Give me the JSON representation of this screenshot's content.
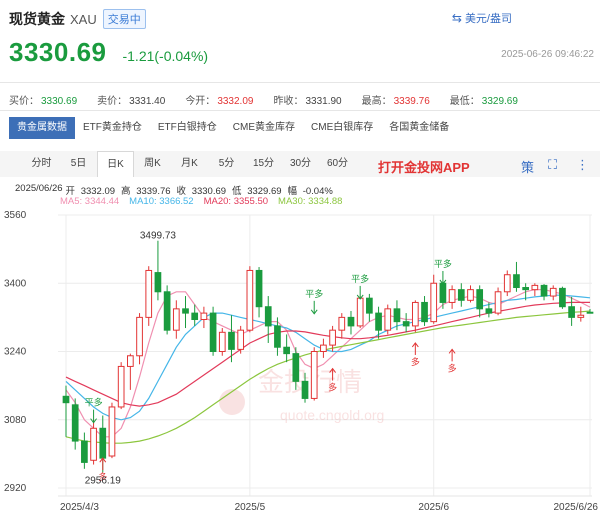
{
  "header": {
    "title": "现货黄金",
    "code": "XAU",
    "status": "交易中",
    "unit_switch": "美元/盎司",
    "price": "3330.69",
    "change": "-1.21(-0.04%)",
    "timestamp": "2025-06-26 09:46:22"
  },
  "quotes": [
    {
      "label": "买价：",
      "value": "3330.69",
      "tone": "down"
    },
    {
      "label": "卖价：",
      "value": "3331.40",
      "tone": "flat"
    },
    {
      "label": "今开：",
      "value": "3332.09",
      "tone": "up"
    },
    {
      "label": "昨收：",
      "value": "3331.90",
      "tone": "flat"
    },
    {
      "label": "最高：",
      "value": "3339.76",
      "tone": "up"
    },
    {
      "label": "最低：",
      "value": "3329.69",
      "tone": "down"
    }
  ],
  "tabs": [
    "贵金属数据",
    "ETF黄金持仓",
    "ETF白银持仓",
    "CME黄金库存",
    "CME白银库存",
    "各国黄金储备"
  ],
  "periods": [
    "分时",
    "5日",
    "日K",
    "周K",
    "月K",
    "5分",
    "15分",
    "30分",
    "60分"
  ],
  "active_period": "日K",
  "app_link": "打开金投网APP",
  "tool_icon": "策",
  "ohlc": {
    "date": "2025/06/26",
    "open_label": "开",
    "open": "3332.09",
    "high_label": "高",
    "high": "3339.76",
    "close_label": "收",
    "close": "3330.69",
    "low_label": "低",
    "low": "3329.69",
    "change_label": "幅",
    "change": "-0.04%"
  },
  "ma": [
    {
      "text": "MA5: 3344.44",
      "color": "#f08fb0"
    },
    {
      "text": "MA10: 3366.52",
      "color": "#45b6e8"
    },
    {
      "text": "MA20: 3355.50",
      "color": "#e23a5a"
    },
    {
      "text": "MA30: 3334.88",
      "color": "#8cc63e"
    }
  ],
  "watermark": "quote.cngold.org",
  "colors": {
    "up": "#e23434",
    "down": "#1a9b3e",
    "accent": "#3d6fb7"
  },
  "chart_data": {
    "type": "candlestick",
    "y_ticks": [
      "3560",
      "3400",
      "3240",
      "3080",
      "2920"
    ],
    "y_tick_values": [
      3560,
      3400,
      3240,
      3080,
      2920
    ],
    "ylim": [
      2920,
      3560
    ],
    "x_ticks": [
      {
        "label": "2025/4/3",
        "index": 0
      },
      {
        "label": "2025/5",
        "index": 20
      },
      {
        "label": "2025/6",
        "index": 40
      },
      {
        "label": "2025/6/26",
        "index": 57
      }
    ],
    "annotations": [
      {
        "label": "3499.73",
        "index": 10,
        "value": 3499.73,
        "kind": "high"
      },
      {
        "label": "2956.19",
        "index": 4,
        "value": 2956.19,
        "kind": "low"
      }
    ],
    "signals": [
      {
        "label": "平多",
        "index": 3,
        "value": 3085,
        "kind": "close-long"
      },
      {
        "label": "多",
        "index": 4,
        "value": 2990,
        "kind": "buy"
      },
      {
        "label": "平多",
        "index": 27,
        "value": 3340,
        "kind": "close-long"
      },
      {
        "label": "多",
        "index": 29,
        "value": 3200,
        "kind": "buy"
      },
      {
        "label": "平多",
        "index": 32,
        "value": 3375,
        "kind": "close-long"
      },
      {
        "label": "多",
        "index": 38,
        "value": 3260,
        "kind": "buy"
      },
      {
        "label": "平多",
        "index": 41,
        "value": 3410,
        "kind": "close-long"
      },
      {
        "label": "多",
        "index": 42,
        "value": 3245,
        "kind": "buy"
      }
    ],
    "candles": [
      {
        "o": 3135,
        "h": 3160,
        "l": 3040,
        "c": 3120
      },
      {
        "o": 3115,
        "h": 3130,
        "l": 3010,
        "c": 3030
      },
      {
        "o": 3030,
        "h": 3050,
        "l": 2965,
        "c": 2980
      },
      {
        "o": 2985,
        "h": 3080,
        "l": 2975,
        "c": 3060
      },
      {
        "o": 3060,
        "h": 3090,
        "l": 2956.19,
        "c": 2990
      },
      {
        "o": 2995,
        "h": 3120,
        "l": 2990,
        "c": 3110
      },
      {
        "o": 3110,
        "h": 3215,
        "l": 3105,
        "c": 3205
      },
      {
        "o": 3205,
        "h": 3235,
        "l": 3150,
        "c": 3230
      },
      {
        "o": 3230,
        "h": 3330,
        "l": 3210,
        "c": 3320
      },
      {
        "o": 3320,
        "h": 3440,
        "l": 3300,
        "c": 3430
      },
      {
        "o": 3425,
        "h": 3499.73,
        "l": 3360,
        "c": 3380
      },
      {
        "o": 3380,
        "h": 3395,
        "l": 3280,
        "c": 3290
      },
      {
        "o": 3290,
        "h": 3360,
        "l": 3270,
        "c": 3340
      },
      {
        "o": 3340,
        "h": 3370,
        "l": 3295,
        "c": 3330
      },
      {
        "o": 3330,
        "h": 3350,
        "l": 3300,
        "c": 3315
      },
      {
        "o": 3315,
        "h": 3345,
        "l": 3295,
        "c": 3330
      },
      {
        "o": 3330,
        "h": 3345,
        "l": 3230,
        "c": 3240
      },
      {
        "o": 3240,
        "h": 3295,
        "l": 3230,
        "c": 3285
      },
      {
        "o": 3285,
        "h": 3325,
        "l": 3215,
        "c": 3245
      },
      {
        "o": 3245,
        "h": 3300,
        "l": 3235,
        "c": 3290
      },
      {
        "o": 3290,
        "h": 3440,
        "l": 3285,
        "c": 3430
      },
      {
        "o": 3430,
        "h": 3438,
        "l": 3320,
        "c": 3345
      },
      {
        "o": 3345,
        "h": 3370,
        "l": 3260,
        "c": 3300
      },
      {
        "o": 3300,
        "h": 3320,
        "l": 3230,
        "c": 3250
      },
      {
        "o": 3250,
        "h": 3280,
        "l": 3215,
        "c": 3235
      },
      {
        "o": 3235,
        "h": 3250,
        "l": 3150,
        "c": 3170
      },
      {
        "o": 3170,
        "h": 3190,
        "l": 3120,
        "c": 3130
      },
      {
        "o": 3130,
        "h": 3250,
        "l": 3125,
        "c": 3240
      },
      {
        "o": 3240,
        "h": 3270,
        "l": 3225,
        "c": 3255
      },
      {
        "o": 3255,
        "h": 3300,
        "l": 3240,
        "c": 3290
      },
      {
        "o": 3290,
        "h": 3330,
        "l": 3270,
        "c": 3320
      },
      {
        "o": 3320,
        "h": 3335,
        "l": 3280,
        "c": 3300
      },
      {
        "o": 3300,
        "h": 3370,
        "l": 3295,
        "c": 3365
      },
      {
        "o": 3365,
        "h": 3375,
        "l": 3310,
        "c": 3330
      },
      {
        "o": 3330,
        "h": 3345,
        "l": 3270,
        "c": 3290
      },
      {
        "o": 3290,
        "h": 3350,
        "l": 3280,
        "c": 3340
      },
      {
        "o": 3340,
        "h": 3360,
        "l": 3290,
        "c": 3310
      },
      {
        "o": 3310,
        "h": 3330,
        "l": 3285,
        "c": 3300
      },
      {
        "o": 3300,
        "h": 3360,
        "l": 3285,
        "c": 3355
      },
      {
        "o": 3355,
        "h": 3370,
        "l": 3300,
        "c": 3310
      },
      {
        "o": 3310,
        "h": 3420,
        "l": 3305,
        "c": 3400
      },
      {
        "o": 3400,
        "h": 3405,
        "l": 3340,
        "c": 3355
      },
      {
        "o": 3355,
        "h": 3395,
        "l": 3340,
        "c": 3385
      },
      {
        "o": 3385,
        "h": 3400,
        "l": 3345,
        "c": 3360
      },
      {
        "o": 3360,
        "h": 3395,
        "l": 3355,
        "c": 3385
      },
      {
        "o": 3385,
        "h": 3395,
        "l": 3320,
        "c": 3340
      },
      {
        "o": 3340,
        "h": 3355,
        "l": 3320,
        "c": 3330
      },
      {
        "o": 3330,
        "h": 3390,
        "l": 3325,
        "c": 3380
      },
      {
        "o": 3380,
        "h": 3430,
        "l": 3370,
        "c": 3420
      },
      {
        "o": 3420,
        "h": 3450,
        "l": 3380,
        "c": 3390
      },
      {
        "o": 3390,
        "h": 3400,
        "l": 3360,
        "c": 3385
      },
      {
        "o": 3385,
        "h": 3400,
        "l": 3370,
        "c": 3395
      },
      {
        "o": 3395,
        "h": 3398,
        "l": 3360,
        "c": 3370
      },
      {
        "o": 3370,
        "h": 3395,
        "l": 3360,
        "c": 3388
      },
      {
        "o": 3388,
        "h": 3392,
        "l": 3340,
        "c": 3345
      },
      {
        "o": 3345,
        "h": 3368,
        "l": 3300,
        "c": 3320
      },
      {
        "o": 3320,
        "h": 3345,
        "l": 3310,
        "c": 3325
      },
      {
        "o": 3332.09,
        "h": 3339.76,
        "l": 3329.69,
        "c": 3330.69
      }
    ],
    "series": [
      {
        "name": "MA5",
        "color": "#f08fb0",
        "values": [
          3150,
          3120,
          3080,
          3060,
          3040,
          3040,
          3060,
          3110,
          3180,
          3260,
          3330,
          3370,
          3380,
          3380,
          3350,
          3320,
          3310,
          3300,
          3290,
          3280,
          3290,
          3300,
          3310,
          3310,
          3290,
          3240,
          3210,
          3200,
          3210,
          3230,
          3250,
          3270,
          3290,
          3310,
          3320,
          3325,
          3320,
          3315,
          3315,
          3320,
          3330,
          3350,
          3360,
          3365,
          3370,
          3365,
          3355,
          3350,
          3360,
          3370,
          3380,
          3385,
          3385,
          3380,
          3375,
          3365,
          3355,
          3344
        ]
      },
      {
        "name": "MA10",
        "color": "#45b6e8",
        "values": [
          3170,
          3150,
          3130,
          3110,
          3095,
          3085,
          3080,
          3085,
          3100,
          3130,
          3170,
          3210,
          3250,
          3280,
          3300,
          3320,
          3330,
          3330,
          3325,
          3320,
          3315,
          3310,
          3305,
          3300,
          3295,
          3285,
          3270,
          3255,
          3245,
          3240,
          3240,
          3245,
          3255,
          3265,
          3280,
          3290,
          3300,
          3305,
          3310,
          3315,
          3320,
          3325,
          3330,
          3335,
          3340,
          3345,
          3350,
          3355,
          3360,
          3362,
          3365,
          3368,
          3370,
          3372,
          3372,
          3370,
          3368,
          3366
        ]
      },
      {
        "name": "MA20",
        "color": "#e23a5a",
        "values": [
          3180,
          3170,
          3160,
          3150,
          3140,
          3130,
          3120,
          3115,
          3112,
          3115,
          3120,
          3130,
          3140,
          3155,
          3170,
          3185,
          3200,
          3215,
          3230,
          3245,
          3260,
          3270,
          3280,
          3285,
          3288,
          3288,
          3286,
          3282,
          3278,
          3275,
          3272,
          3270,
          3270,
          3272,
          3275,
          3278,
          3282,
          3286,
          3290,
          3295,
          3300,
          3305,
          3310,
          3315,
          3320,
          3325,
          3330,
          3334,
          3338,
          3342,
          3346,
          3349,
          3351,
          3353,
          3354,
          3355,
          3355,
          3355
        ]
      },
      {
        "name": "MA30",
        "color": "#8cc63e",
        "values": [
          3040,
          3035,
          3030,
          3028,
          3026,
          3025,
          3025,
          3027,
          3030,
          3035,
          3042,
          3050,
          3060,
          3072,
          3085,
          3100,
          3115,
          3130,
          3145,
          3160,
          3175,
          3188,
          3200,
          3210,
          3218,
          3225,
          3232,
          3238,
          3243,
          3248,
          3252,
          3256,
          3260,
          3264,
          3268,
          3272,
          3276,
          3280,
          3284,
          3288,
          3292,
          3296,
          3299,
          3302,
          3305,
          3308,
          3311,
          3314,
          3317,
          3320,
          3322,
          3324,
          3326,
          3328,
          3330,
          3332,
          3333,
          3334.88
        ]
      }
    ]
  }
}
